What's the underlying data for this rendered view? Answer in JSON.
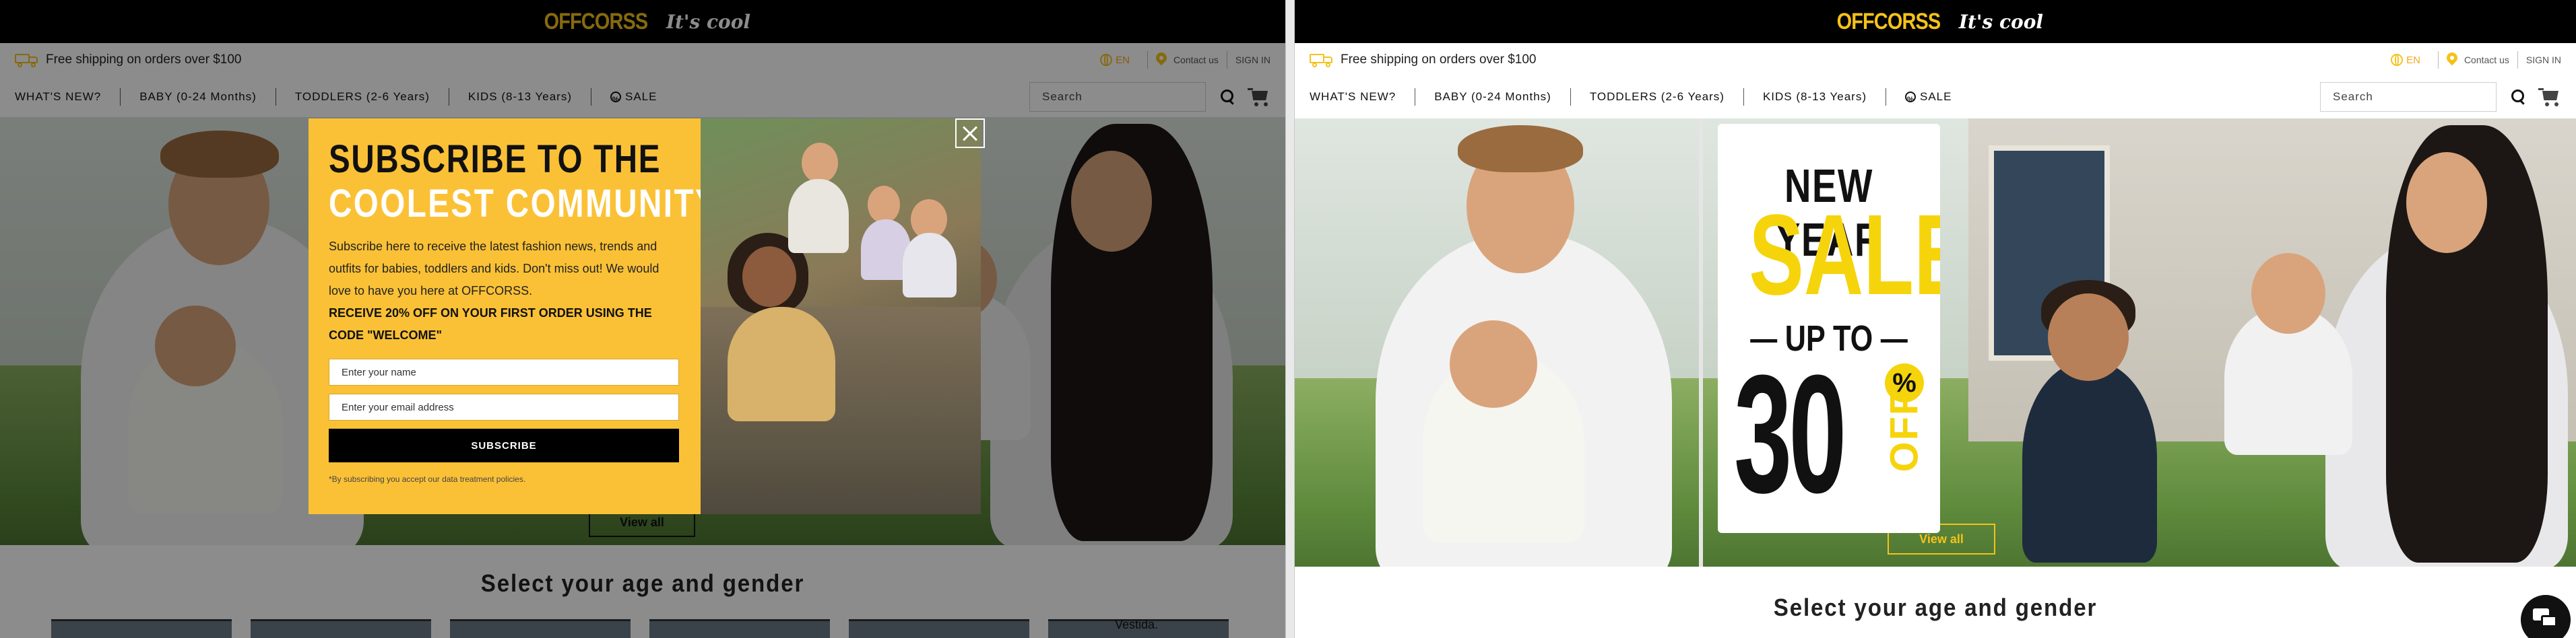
{
  "left": {
    "brand": {
      "name": "OFFCORSS",
      "tagline": "It's cool"
    },
    "utility": {
      "shipping": "Free shipping on orders over $100",
      "lang": "EN",
      "contact": "Contact us",
      "signin": "SIGN IN"
    },
    "nav": [
      "WHAT'S NEW?",
      "BABY (0-24 Months)",
      "TODDLERS (2-6 Years)",
      "KIDS (8-13 Years)"
    ],
    "nav_sale": "SALE",
    "search": {
      "placeholder": "Search"
    },
    "hero_cta": "View all",
    "section_title": "Select your age and gender",
    "thumb_label": "Vestida.",
    "modal": {
      "title_line1": "SUBSCRIBE TO THE",
      "title_line2": "COOLEST COMMUNITY",
      "body": "Subscribe here to receive the latest fashion news, trends and outfits for babies, toddlers and kids. Don't miss out! We would love to have you here at OFFCORSS.",
      "offer": "RECEIVE 20% OFF ON YOUR FIRST ORDER USING THE CODE \"WELCOME\"",
      "name_placeholder": "Enter your name",
      "email_placeholder": "Enter your email address",
      "subscribe": "SUBSCRIBE",
      "note": "*By subscribing you accept our data treatment policies."
    }
  },
  "right": {
    "brand": {
      "name": "OFFCORSS",
      "tagline": "It's cool"
    },
    "utility": {
      "shipping": "Free shipping on orders over $100",
      "lang": "EN",
      "contact": "Contact us",
      "signin": "SIGN IN"
    },
    "nav": [
      "WHAT'S NEW?",
      "BABY (0-24 Months)",
      "TODDLERS (2-6 Years)",
      "KIDS (8-13 Years)"
    ],
    "nav_sale": "SALE",
    "search": {
      "placeholder": "Search"
    },
    "sale_card": {
      "line1": "NEW YEAR",
      "line2": "SALE",
      "line3": "UP TO",
      "amount": "30",
      "pct": "%",
      "off": "OFF"
    },
    "hero_cta": "View all",
    "section_title": "Select your age and gender"
  },
  "colors": {
    "brand_yellow": "#f5c21a",
    "modal_yellow": "#fbc136",
    "sale_yellow": "#f5d40c",
    "black": "#000000"
  }
}
